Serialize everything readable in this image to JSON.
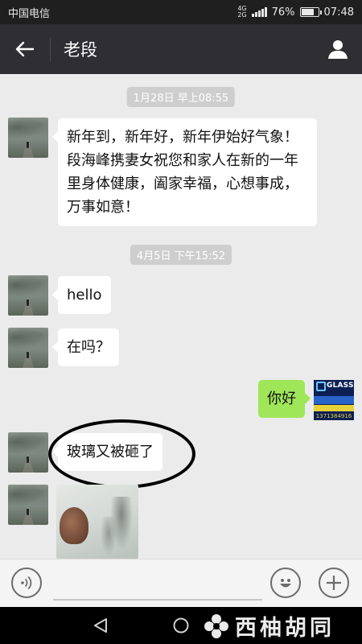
{
  "status_bar": {
    "carrier": "中国电信",
    "network_top": "4G",
    "network_bottom": "2G",
    "battery_percent": "76%",
    "battery_level": 0.76,
    "time": "07:48"
  },
  "header": {
    "title": "老段",
    "back_icon": "arrow-left-icon",
    "profile_icon": "person-icon"
  },
  "messages": [
    {
      "type": "time",
      "text": "1月28日 早上08:55"
    },
    {
      "type": "text",
      "side": "left",
      "text": "新年到，新年好，新年伊始好气象！段海峰携妻女祝您和家人在新的一年里身体健康，阖家幸福，心想事成，万事如意！"
    },
    {
      "type": "time",
      "text": "4月5日 下午15:52"
    },
    {
      "type": "text",
      "side": "left",
      "text": "hello"
    },
    {
      "type": "text",
      "side": "left",
      "text": "在吗？"
    },
    {
      "type": "text",
      "side": "right",
      "text": "你好"
    },
    {
      "type": "text",
      "side": "left",
      "text": "玻璃又被砸了"
    },
    {
      "type": "image",
      "side": "left"
    }
  ],
  "my_avatar": {
    "brand": "GLASS",
    "phone": "1371384916"
  },
  "input_bar": {
    "voice_icon": "voice-icon",
    "emoji_icon": "emoji-icon",
    "plus_icon": "plus-icon"
  },
  "nav_bar": {
    "watermark": "西柚胡同"
  },
  "colors": {
    "header_bg": "#2e2e33",
    "chat_bg": "#ebebeb",
    "my_bubble": "#9fe658",
    "their_bubble": "#ffffff"
  }
}
